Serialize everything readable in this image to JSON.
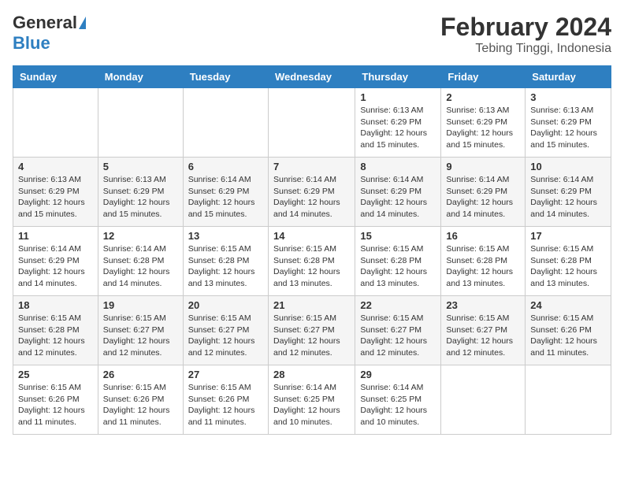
{
  "logo": {
    "line1": "General",
    "line2": "Blue"
  },
  "title": "February 2024",
  "subtitle": "Tebing Tinggi, Indonesia",
  "weekdays": [
    "Sunday",
    "Monday",
    "Tuesday",
    "Wednesday",
    "Thursday",
    "Friday",
    "Saturday"
  ],
  "weeks": [
    [
      {
        "day": "",
        "info": ""
      },
      {
        "day": "",
        "info": ""
      },
      {
        "day": "",
        "info": ""
      },
      {
        "day": "",
        "info": ""
      },
      {
        "day": "1",
        "info": "Sunrise: 6:13 AM\nSunset: 6:29 PM\nDaylight: 12 hours and 15 minutes."
      },
      {
        "day": "2",
        "info": "Sunrise: 6:13 AM\nSunset: 6:29 PM\nDaylight: 12 hours and 15 minutes."
      },
      {
        "day": "3",
        "info": "Sunrise: 6:13 AM\nSunset: 6:29 PM\nDaylight: 12 hours and 15 minutes."
      }
    ],
    [
      {
        "day": "4",
        "info": "Sunrise: 6:13 AM\nSunset: 6:29 PM\nDaylight: 12 hours and 15 minutes."
      },
      {
        "day": "5",
        "info": "Sunrise: 6:13 AM\nSunset: 6:29 PM\nDaylight: 12 hours and 15 minutes."
      },
      {
        "day": "6",
        "info": "Sunrise: 6:14 AM\nSunset: 6:29 PM\nDaylight: 12 hours and 15 minutes."
      },
      {
        "day": "7",
        "info": "Sunrise: 6:14 AM\nSunset: 6:29 PM\nDaylight: 12 hours and 14 minutes."
      },
      {
        "day": "8",
        "info": "Sunrise: 6:14 AM\nSunset: 6:29 PM\nDaylight: 12 hours and 14 minutes."
      },
      {
        "day": "9",
        "info": "Sunrise: 6:14 AM\nSunset: 6:29 PM\nDaylight: 12 hours and 14 minutes."
      },
      {
        "day": "10",
        "info": "Sunrise: 6:14 AM\nSunset: 6:29 PM\nDaylight: 12 hours and 14 minutes."
      }
    ],
    [
      {
        "day": "11",
        "info": "Sunrise: 6:14 AM\nSunset: 6:29 PM\nDaylight: 12 hours and 14 minutes."
      },
      {
        "day": "12",
        "info": "Sunrise: 6:14 AM\nSunset: 6:28 PM\nDaylight: 12 hours and 14 minutes."
      },
      {
        "day": "13",
        "info": "Sunrise: 6:15 AM\nSunset: 6:28 PM\nDaylight: 12 hours and 13 minutes."
      },
      {
        "day": "14",
        "info": "Sunrise: 6:15 AM\nSunset: 6:28 PM\nDaylight: 12 hours and 13 minutes."
      },
      {
        "day": "15",
        "info": "Sunrise: 6:15 AM\nSunset: 6:28 PM\nDaylight: 12 hours and 13 minutes."
      },
      {
        "day": "16",
        "info": "Sunrise: 6:15 AM\nSunset: 6:28 PM\nDaylight: 12 hours and 13 minutes."
      },
      {
        "day": "17",
        "info": "Sunrise: 6:15 AM\nSunset: 6:28 PM\nDaylight: 12 hours and 13 minutes."
      }
    ],
    [
      {
        "day": "18",
        "info": "Sunrise: 6:15 AM\nSunset: 6:28 PM\nDaylight: 12 hours and 12 minutes."
      },
      {
        "day": "19",
        "info": "Sunrise: 6:15 AM\nSunset: 6:27 PM\nDaylight: 12 hours and 12 minutes."
      },
      {
        "day": "20",
        "info": "Sunrise: 6:15 AM\nSunset: 6:27 PM\nDaylight: 12 hours and 12 minutes."
      },
      {
        "day": "21",
        "info": "Sunrise: 6:15 AM\nSunset: 6:27 PM\nDaylight: 12 hours and 12 minutes."
      },
      {
        "day": "22",
        "info": "Sunrise: 6:15 AM\nSunset: 6:27 PM\nDaylight: 12 hours and 12 minutes."
      },
      {
        "day": "23",
        "info": "Sunrise: 6:15 AM\nSunset: 6:27 PM\nDaylight: 12 hours and 12 minutes."
      },
      {
        "day": "24",
        "info": "Sunrise: 6:15 AM\nSunset: 6:26 PM\nDaylight: 12 hours and 11 minutes."
      }
    ],
    [
      {
        "day": "25",
        "info": "Sunrise: 6:15 AM\nSunset: 6:26 PM\nDaylight: 12 hours and 11 minutes."
      },
      {
        "day": "26",
        "info": "Sunrise: 6:15 AM\nSunset: 6:26 PM\nDaylight: 12 hours and 11 minutes."
      },
      {
        "day": "27",
        "info": "Sunrise: 6:15 AM\nSunset: 6:26 PM\nDaylight: 12 hours and 11 minutes."
      },
      {
        "day": "28",
        "info": "Sunrise: 6:14 AM\nSunset: 6:25 PM\nDaylight: 12 hours and 10 minutes."
      },
      {
        "day": "29",
        "info": "Sunrise: 6:14 AM\nSunset: 6:25 PM\nDaylight: 12 hours and 10 minutes."
      },
      {
        "day": "",
        "info": ""
      },
      {
        "day": "",
        "info": ""
      }
    ]
  ],
  "colors": {
    "header_bg": "#2e7fc1",
    "header_text": "#ffffff",
    "logo_blue": "#1a6fb5"
  }
}
